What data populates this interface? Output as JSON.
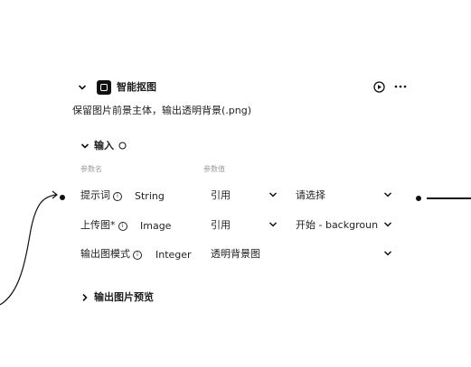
{
  "node": {
    "title": "智能抠图",
    "description": "保留图片前景主体，输出透明背景(.png)"
  },
  "inputs_section": {
    "label": "输入",
    "columns": [
      "参数名",
      "参数值"
    ],
    "rows": [
      {
        "name": "提示词",
        "type": "String",
        "mode": "引用",
        "value": "请选择"
      },
      {
        "name": "上传图*",
        "type": "Image",
        "mode": "引用",
        "value": "开始 - backgroun"
      },
      {
        "name": "输出图模式",
        "type": "Integer",
        "mode": "透明背景图",
        "value": ""
      }
    ]
  },
  "preview_section": {
    "label": "输出图片预览"
  },
  "icons": {
    "run": "play-circle-icon",
    "more": "more-icon",
    "collapse": "chevron-down-icon",
    "expand": "chevron-right-icon",
    "info": "info-icon",
    "refresh": "refresh-icon"
  },
  "colors": {
    "text": "#1f1f1f",
    "faint": "#9a9a9a",
    "connector": "#111111"
  }
}
